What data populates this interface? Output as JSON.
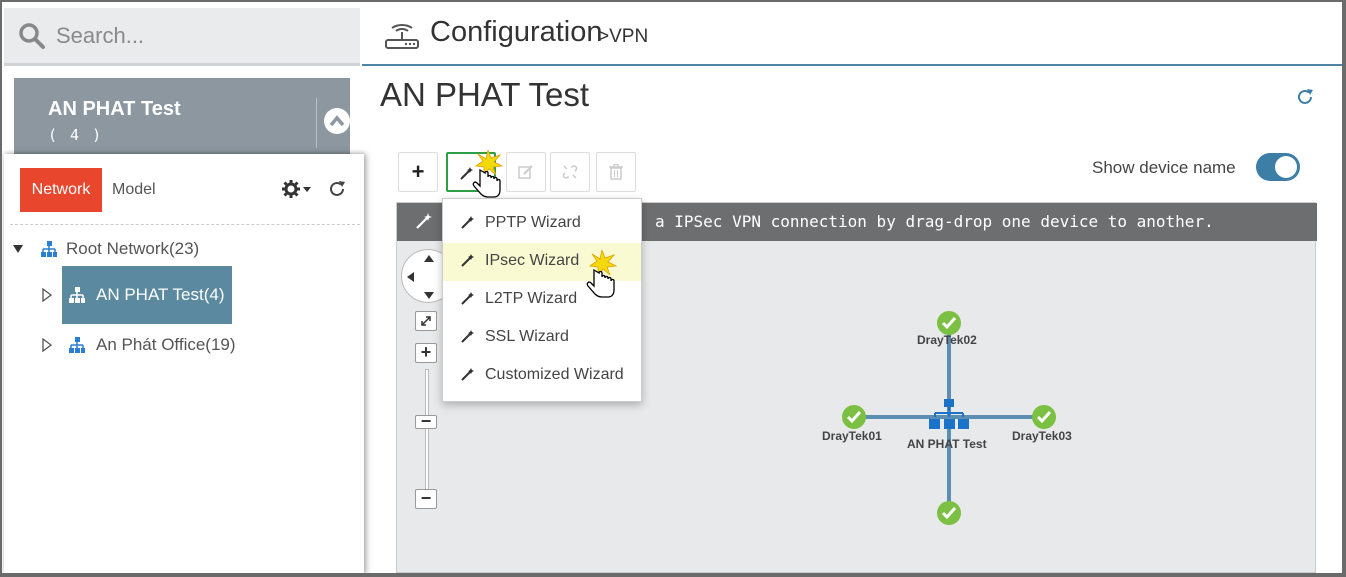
{
  "search": {
    "placeholder": "Search..."
  },
  "group_card": {
    "name": "AN PHAT Test",
    "count": "( 4 )"
  },
  "left_tabs": {
    "network": "Network",
    "model": "Model"
  },
  "tree": {
    "root": "Root Network(23)",
    "items": [
      {
        "label": "AN PHAT Test(4)",
        "selected": true
      },
      {
        "label": "An Phát Office(19)",
        "selected": false
      }
    ]
  },
  "header": {
    "title": "Configuration",
    "breadcrumb": ">VPN"
  },
  "page_title": "AN PHAT Test",
  "toolbar": {
    "add_label": "+",
    "show_device_name_label": "Show device name",
    "show_device_name_on": true
  },
  "hint_text": "a IPSec VPN connection by drag-drop one device to another.",
  "wizard_menu": [
    {
      "label": "PPTP Wizard",
      "highlighted": false
    },
    {
      "label": "IPsec Wizard",
      "highlighted": true
    },
    {
      "label": "L2TP Wizard",
      "highlighted": false
    },
    {
      "label": "SSL Wizard",
      "highlighted": false
    },
    {
      "label": "Customized Wizard",
      "highlighted": false
    }
  ],
  "topology": {
    "center": "AN PHAT Test",
    "nodes": [
      "DrayTek02",
      "DrayTek01",
      "DrayTek03"
    ]
  },
  "zoom_controls": {
    "plus": "+",
    "minus": "−"
  },
  "colors": {
    "accent_red": "#e8472e",
    "accent_blue": "#3d7ea6",
    "status_green": "#7cc043",
    "node_blue": "#1a73c8"
  }
}
